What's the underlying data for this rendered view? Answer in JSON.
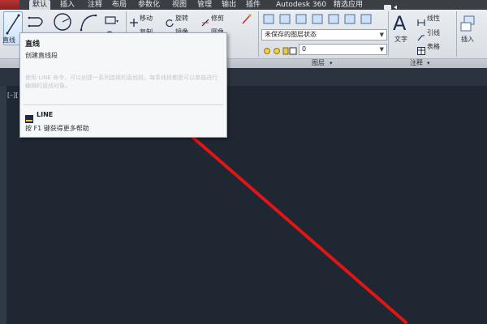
{
  "ribbon_tabs": [
    "默认",
    "插入",
    "注释",
    "布局",
    "参数化",
    "视图",
    "管理",
    "输出",
    "插件",
    "Autodesk 360",
    "精选应用"
  ],
  "ribbon": {
    "draw": {
      "line_label": "直线"
    },
    "modify": {
      "move": "移动",
      "rotate": "旋转",
      "trim": "修剪",
      "copy": "复制",
      "mirror": "镜像",
      "fillet": "圆角"
    },
    "layers": {
      "state_value": "未保存的图层状态",
      "layer_value": "0",
      "title": "图层"
    },
    "annotation": {
      "text": "文字",
      "linear": "线性",
      "leader": "引线",
      "table": "表格",
      "title": "注释"
    },
    "insert": {
      "label": "插入"
    }
  },
  "tooltip": {
    "title": "直线",
    "subtitle": "创建直线段",
    "description": "使用 LINE 命令，可以创建一系列连续的直线段。每条线段都是可以单独进行编辑的直线对象。",
    "command": "LINE",
    "help": "按 F1 键获得更多帮助"
  },
  "viewport": {
    "label": "[–]["
  },
  "colors": {
    "arrow": "#e01515",
    "canvas_bg": "#1f2733",
    "ribbon_bg": "#dde1e6"
  }
}
